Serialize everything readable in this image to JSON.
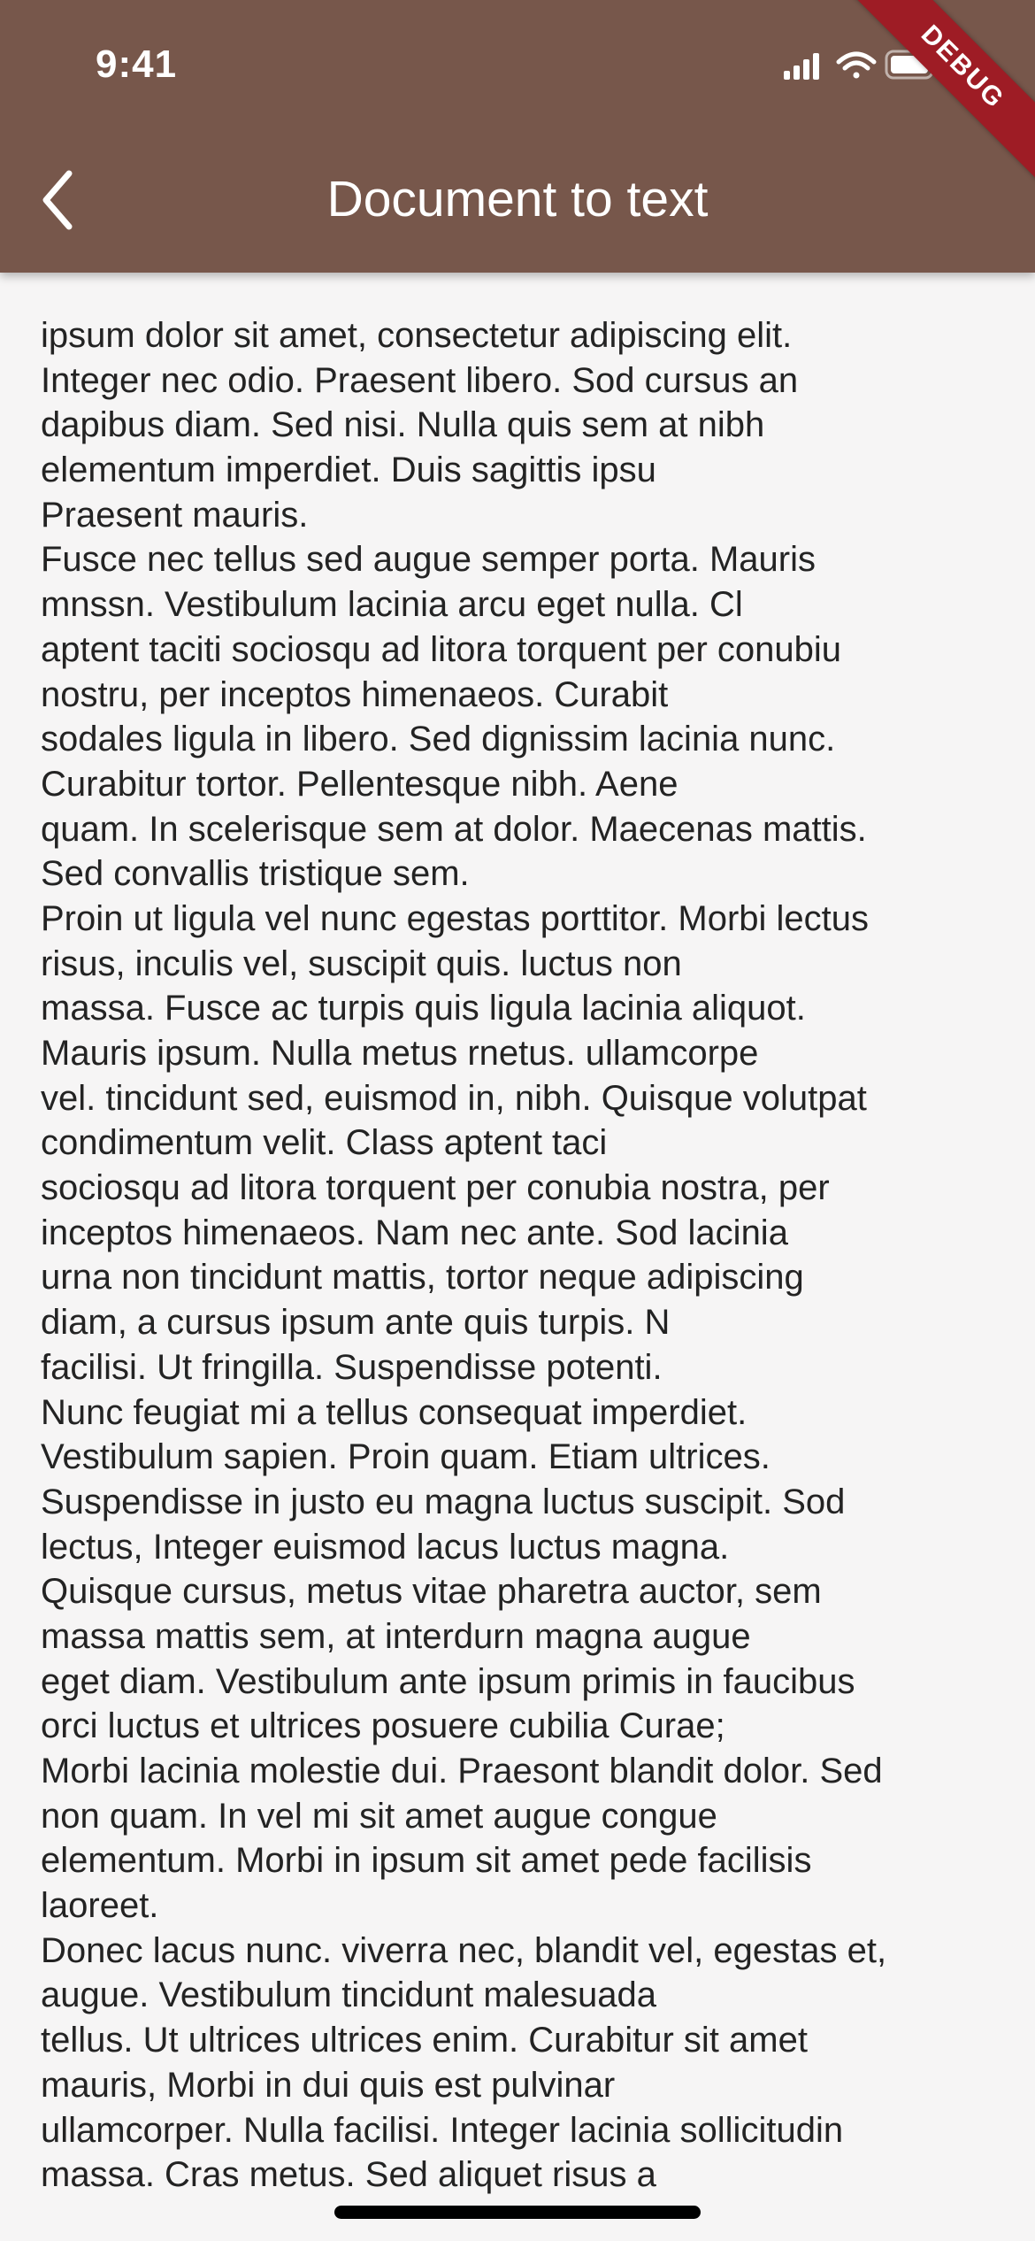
{
  "status_bar": {
    "time": "9:41",
    "icons": [
      "cellular-signal-icon",
      "wifi-icon",
      "battery-icon"
    ]
  },
  "app_bar": {
    "title": "Document to text",
    "back_icon": "chevron-left-icon",
    "background_color": "#77574b"
  },
  "debug_banner": {
    "label": "DEBUG",
    "color": "#9e1c25"
  },
  "document": {
    "lines": [
      "ipsum dolor sit amet, consectetur adipiscing elit.",
      "Integer nec odio. Praesent libero. Sod cursus an",
      "dapibus diam. Sed nisi. Nulla quis sem at nibh",
      "elementum imperdiet. Duis sagittis ipsu",
      "Praesent mauris.",
      "Fusce nec tellus sed augue semper porta. Mauris",
      "mnssn. Vestibulum lacinia arcu eget nulla. Cl",
      "aptent taciti sociosqu ad litora torquent per conubiu",
      "nostru, per inceptos himenaeos. Curabit",
      "sodales ligula in libero. Sed dignissim lacinia nunc.",
      "Curabitur tortor. Pellentesque nibh. Aene",
      "quam. In scelerisque sem at dolor. Maecenas mattis.",
      "Sed convallis tristique sem.",
      "Proin ut ligula vel nunc egestas porttitor. Morbi lectus",
      "risus, inculis vel, suscipit quis. luctus non",
      "massa. Fusce ac turpis quis ligula lacinia aliquot.",
      "Mauris ipsum. Nulla metus rnetus. ullamcorpe",
      "vel. tincidunt sed, euismod in, nibh. Quisque volutpat",
      "condimentum velit. Class aptent taci",
      "sociosqu ad litora torquent per conubia nostra, per",
      "inceptos himenaeos. Nam nec ante. Sod lacinia",
      "urna non tincidunt mattis, tortor neque adipiscing",
      "diam, a cursus ipsum ante quis turpis. N",
      "facilisi. Ut fringilla. Suspendisse potenti.",
      "Nunc feugiat mi a tellus consequat imperdiet.",
      "Vestibulum sapien. Proin quam. Etiam ultrices.",
      "Suspendisse in justo eu magna luctus suscipit. Sod",
      "lectus, Integer euismod lacus luctus magna.",
      "Quisque cursus, metus vitae pharetra auctor, sem",
      "massa mattis sem, at interdurn magna augue",
      "eget diam. Vestibulum ante ipsum primis in faucibus",
      "orci luctus et ultrices posuere cubilia Curae;",
      "Morbi lacinia molestie dui. Praesont blandit dolor. Sed",
      "non quam. In vel mi sit amet augue congue",
      "elementum. Morbi in ipsum sit amet pede facilisis",
      "laoreet.",
      "Donec lacus nunc. viverra nec, blandit vel, egestas et,",
      "augue. Vestibulum tincidunt malesuada",
      "tellus. Ut ultrices ultrices enim. Curabitur sit amet",
      "mauris, Morbi in dui quis est pulvinar",
      "ullamcorper. Nulla facilisi. Integer lacinia sollicitudin",
      "massa. Cras metus. Sed aliquet risus a"
    ]
  }
}
